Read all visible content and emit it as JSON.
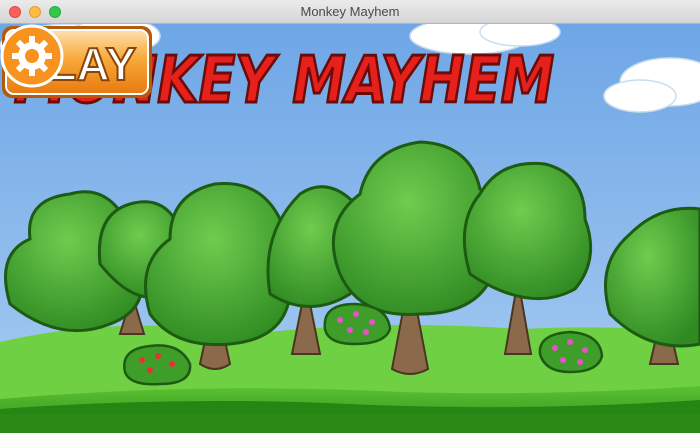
{
  "window": {
    "title": "Monkey Mayhem"
  },
  "game": {
    "title_text": "MONKEY MAYHEM",
    "play_label": "PLAY",
    "settings_icon": "gear-icon"
  },
  "colors": {
    "sky": "#7fb2ea",
    "title_red": "#e8201c",
    "button_orange": "#f7931e",
    "grass": "#2f9a1c",
    "tree_green": "#3f9e2a"
  }
}
